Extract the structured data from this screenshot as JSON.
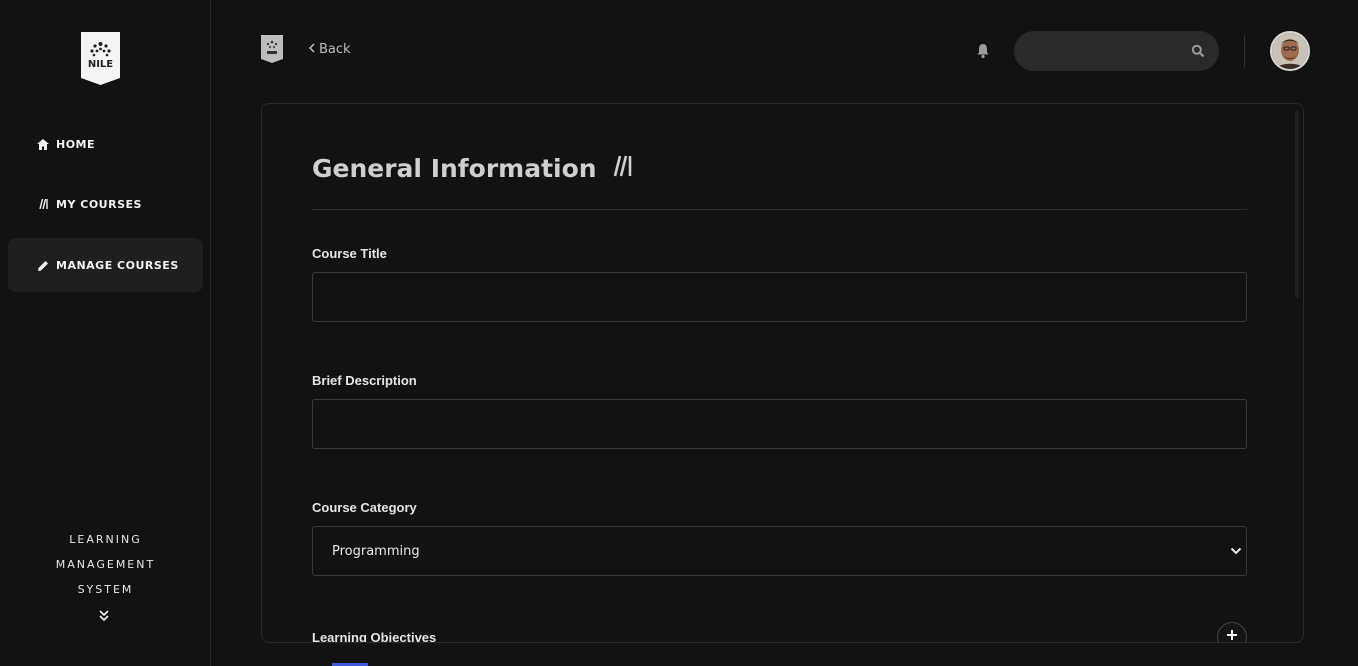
{
  "sidebar": {
    "logo_text": "NILE",
    "items": [
      {
        "label": "HOME",
        "icon": "home-icon"
      },
      {
        "label": "MY COURSES",
        "icon": "books-icon"
      },
      {
        "label": "MANAGE COURSES",
        "icon": "pencil-icon",
        "active": true
      }
    ],
    "brand_lines": [
      "LEARNING",
      "MANAGEMENT",
      "SYSTEM"
    ],
    "expand_icon": "chevrons-down-icon"
  },
  "topbar": {
    "back_label": "Back",
    "search": {
      "placeholder": "",
      "value": ""
    },
    "bell_icon": "bell-icon",
    "avatar_icon": "user-avatar"
  },
  "form": {
    "title": "General Information",
    "fields": {
      "course_title": {
        "label": "Course Title",
        "value": ""
      },
      "brief_description": {
        "label": "Brief Description",
        "value": ""
      },
      "course_category": {
        "label": "Course Category",
        "selected": "Programming"
      },
      "learning_objectives": {
        "label": "Learning Objectives"
      }
    }
  },
  "colors": {
    "background": "#121212",
    "active_nav": "#1f1f1f",
    "accent": "#3f5bd8"
  }
}
